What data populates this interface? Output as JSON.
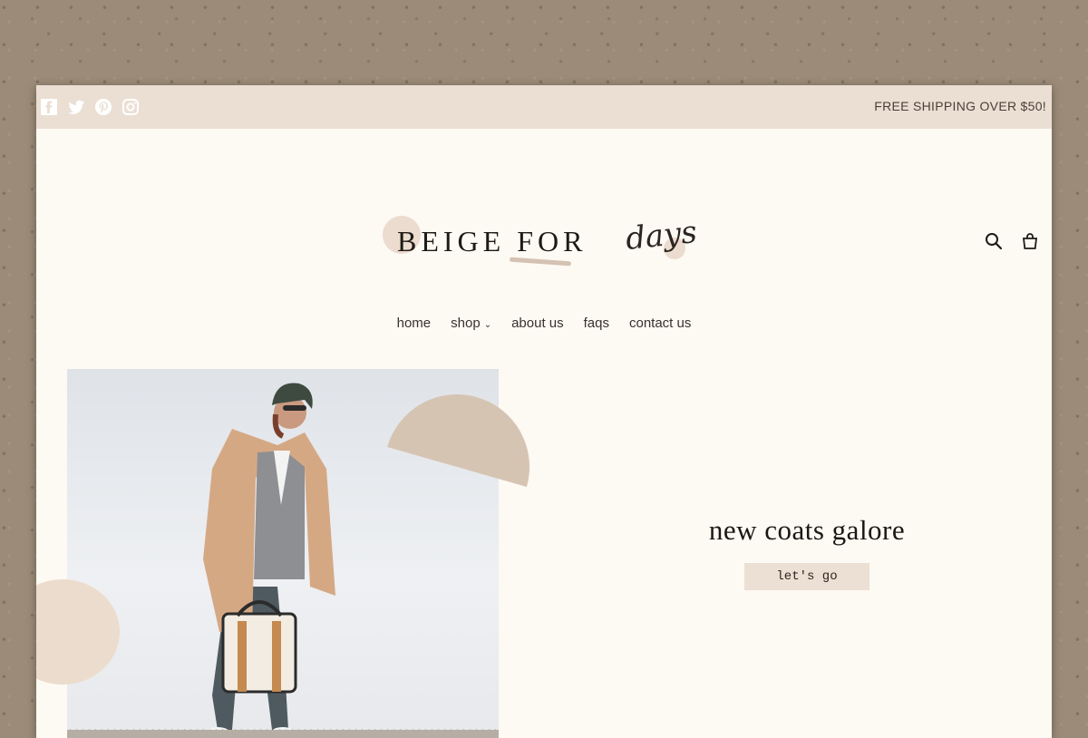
{
  "announcement": "FREE SHIPPING OVER $50!",
  "socials": [
    {
      "icon": "facebook-icon"
    },
    {
      "icon": "twitter-icon"
    },
    {
      "icon": "pinterest-icon"
    },
    {
      "icon": "instagram-icon"
    }
  ],
  "logo": {
    "main": "BEIGE FOR",
    "script": "days"
  },
  "header_icons": {
    "search": "search-icon",
    "cart": "cart-icon"
  },
  "nav": {
    "home": "home",
    "shop": "shop",
    "shop_chevron": "⌄",
    "about": "about us",
    "faqs": "faqs",
    "contact": "contact us"
  },
  "hero": {
    "title": "new coats galore",
    "button": "let's go"
  },
  "colors": {
    "topbar": "#ebdfd4",
    "page": "#fdf9f3",
    "accent": "#d6c4b3",
    "button": "#ecdfd3"
  }
}
